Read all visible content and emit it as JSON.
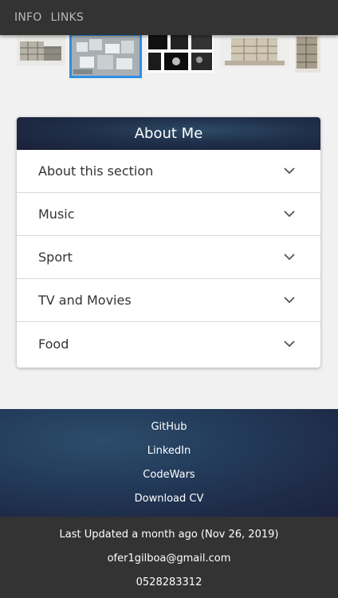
{
  "nav": {
    "items": [
      "INFO",
      "LINKS"
    ]
  },
  "about": {
    "title": "About Me",
    "items": [
      "About this section",
      "Music",
      "Sport",
      "TV and Movies",
      "Food"
    ]
  },
  "links": [
    "GitHub",
    "LinkedIn",
    "CodeWars",
    "Download CV"
  ],
  "footer": {
    "updated": "Last Updated a month ago (Nov 26, 2019)",
    "email": "ofer1gilboa@gmail.com",
    "phone": "0528283312"
  },
  "colors": {
    "header_bar": "#333333",
    "page_bg": "#f1f1f1",
    "selected_border": "#2d8ee6",
    "footer_blue": "#233b5a"
  }
}
